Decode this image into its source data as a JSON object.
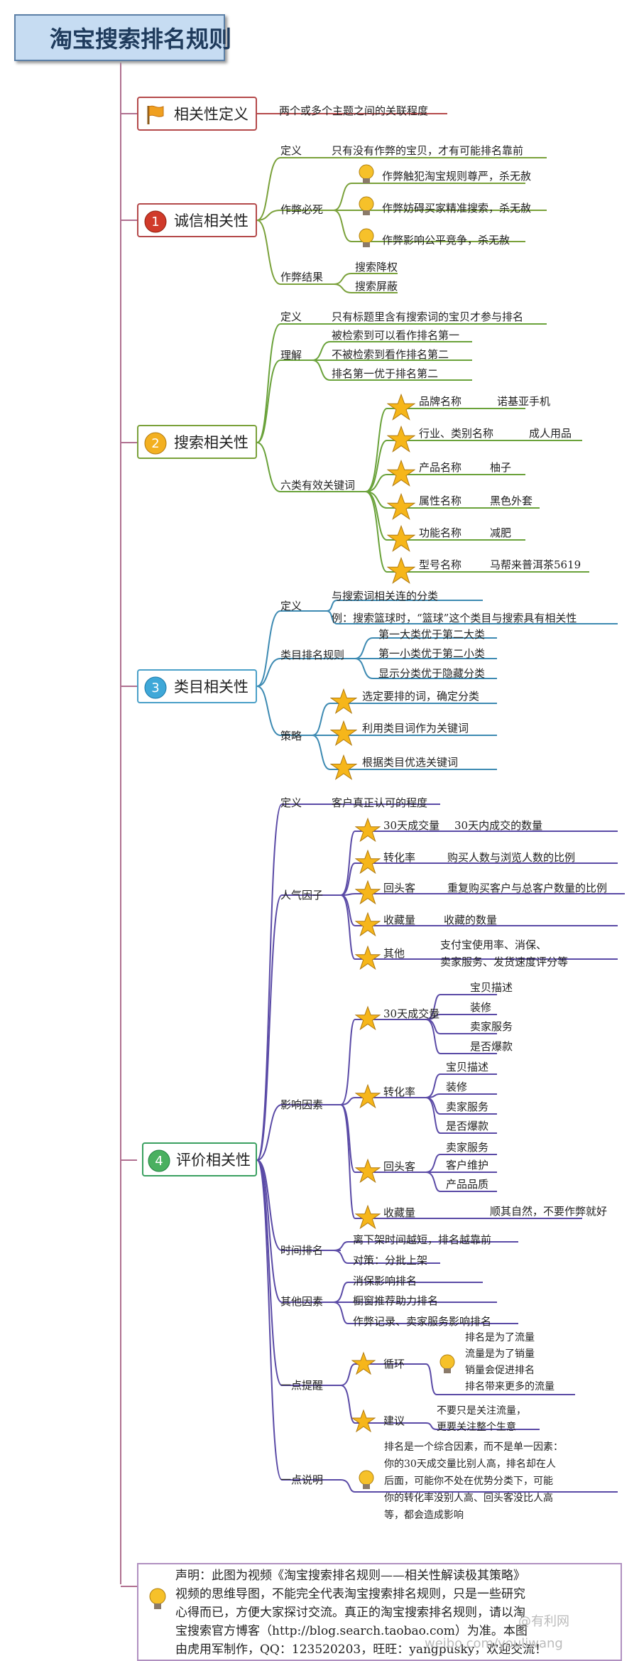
{
  "title": "淘宝搜索排名规则",
  "branches": {
    "b0": {
      "label": "相关性定义",
      "def": "两个或多个主题之间的关联程度"
    },
    "b1": {
      "label": "诚信相关性",
      "def_k": "定义",
      "def_v": "只有没有作弊的宝贝，才有可能排名靠前",
      "cheat_k": "作弊必死",
      "cheat": [
        "作弊触犯淘宝规则尊严，杀无赦",
        "作弊妨碍买家精准搜索，杀无赦",
        "作弊影响公平竞争，杀无赦"
      ],
      "result_k": "作弊结果",
      "result": [
        "搜索降权",
        "搜索屏蔽"
      ]
    },
    "b2": {
      "label": "搜索相关性",
      "def_k": "定义",
      "def_v": "只有标题里含有搜索词的宝贝才参与排名",
      "und_k": "理解",
      "und": [
        "被检索到可以看作排名第一",
        "不被检索到看作排名第二",
        "排名第一优于排名第二"
      ],
      "kw_k": "六类有效关键词",
      "kw": [
        {
          "k": "品牌名称",
          "v": "诺基亚手机"
        },
        {
          "k": "行业、类别名称",
          "v": "成人用品"
        },
        {
          "k": "产品名称",
          "v": "柚子"
        },
        {
          "k": "属性名称",
          "v": "黑色外套"
        },
        {
          "k": "功能名称",
          "v": "减肥"
        },
        {
          "k": "型号名称",
          "v": "马帮来普洱茶5619"
        }
      ]
    },
    "b3": {
      "label": "类目相关性",
      "def_k": "定义",
      "def": [
        "与搜索词相关连的分类",
        "例：搜索篮球时，“篮球”这个类目与搜索具有相关性"
      ],
      "rank_k": "类目排名规则",
      "rank": [
        "第一大类优于第二大类",
        "第一小类优于第二小类",
        "显示分类优于隐藏分类"
      ],
      "st_k": "策略",
      "st": [
        "选定要排的词，确定分类",
        "利用类目词作为关键词",
        "根据类目优选关键词"
      ]
    },
    "b4": {
      "label": "评价相关性",
      "def_k": "定义",
      "def_v": "客户真正认可的程度",
      "pop_k": "人气因子",
      "pop": [
        {
          "k": "30天成交量",
          "v": "30天内成交的数量"
        },
        {
          "k": "转化率",
          "v": "购买人数与浏览人数的比例"
        },
        {
          "k": "回头客",
          "v": "重复购买客户与总客户数量的比例"
        },
        {
          "k": "收藏量",
          "v": "收藏的数量"
        },
        {
          "k": "其他",
          "v1": "支付宝使用率、消保、",
          "v2": "卖家服务、发货速度评分等"
        }
      ],
      "inf_k": "影响因素",
      "inf": [
        {
          "k": "30天成交量",
          "v": [
            "宝贝描述",
            "装修",
            "卖家服务",
            "是否爆款"
          ]
        },
        {
          "k": "转化率",
          "v": [
            "宝贝描述",
            "装修",
            "卖家服务",
            "是否爆款"
          ]
        },
        {
          "k": "回头客",
          "v": [
            "卖家服务",
            "客户维护",
            "产品品质"
          ]
        },
        {
          "k": "收藏量",
          "v": [
            "顺其自然，不要作弊就好"
          ]
        }
      ],
      "time_k": "时间排名",
      "time": [
        "离下架时间越短，排名越靠前",
        "对策：分批上架"
      ],
      "oth_k": "其他因素",
      "oth": [
        "消保影响排名",
        "橱窗推荐助力排名",
        "作弊记录、卖家服务影响排名"
      ],
      "tip_k": "一点提醒",
      "cycle_k": "循环",
      "cycle": [
        "排名是为了流量",
        "流量是为了销量",
        "销量会促进排名",
        "排名带来更多的流量"
      ],
      "adv_k": "建议",
      "adv": [
        "不要只是关注流量，",
        "更要关注整个生意"
      ],
      "exp_k": "一点说明",
      "exp": [
        "排名是一个综合因素，而不是单一因素：",
        "你的30天成交量比别人高，排名却在人",
        "后面，可能你不处在优势分类下，可能",
        "你的转化率没别人高、回头客没比人高",
        "等，都会造成影响"
      ]
    }
  },
  "note": [
    "声明：此图为视频《淘宝搜索排名规则——相关性解读极其策略》",
    "视频的思维导图，不能完全代表淘宝搜索排名规则，只是一些研究",
    "心得而已，方便大家探讨交流。真正的淘宝搜索排名规则，请以淘",
    "宝搜索官方博客（http://blog.search.taobao.com）为准。本图",
    "由虎用军制作，QQ：123520203，旺旺：yangpusky，欢迎交流！"
  ],
  "watermark": [
    "@有利网",
    "weibo.com/youliwang"
  ],
  "badges": [
    "1",
    "2",
    "3",
    "4"
  ],
  "colors": {
    "title_bg": "#c6dcf2",
    "trunk": "#b07090",
    "b2": "#7aa13a",
    "b3": "#3d8ab2",
    "b4": "#5a4aa6"
  }
}
